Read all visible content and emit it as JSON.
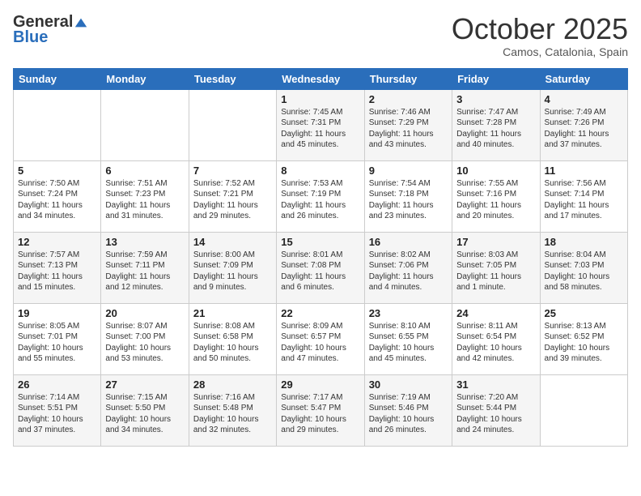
{
  "logo": {
    "general": "General",
    "blue": "Blue"
  },
  "title": "October 2025",
  "location": "Camos, Catalonia, Spain",
  "days_of_week": [
    "Sunday",
    "Monday",
    "Tuesday",
    "Wednesday",
    "Thursday",
    "Friday",
    "Saturday"
  ],
  "weeks": [
    [
      {
        "day": "",
        "info": ""
      },
      {
        "day": "",
        "info": ""
      },
      {
        "day": "",
        "info": ""
      },
      {
        "day": "1",
        "info": "Sunrise: 7:45 AM\nSunset: 7:31 PM\nDaylight: 11 hours and 45 minutes."
      },
      {
        "day": "2",
        "info": "Sunrise: 7:46 AM\nSunset: 7:29 PM\nDaylight: 11 hours and 43 minutes."
      },
      {
        "day": "3",
        "info": "Sunrise: 7:47 AM\nSunset: 7:28 PM\nDaylight: 11 hours and 40 minutes."
      },
      {
        "day": "4",
        "info": "Sunrise: 7:49 AM\nSunset: 7:26 PM\nDaylight: 11 hours and 37 minutes."
      }
    ],
    [
      {
        "day": "5",
        "info": "Sunrise: 7:50 AM\nSunset: 7:24 PM\nDaylight: 11 hours and 34 minutes."
      },
      {
        "day": "6",
        "info": "Sunrise: 7:51 AM\nSunset: 7:23 PM\nDaylight: 11 hours and 31 minutes."
      },
      {
        "day": "7",
        "info": "Sunrise: 7:52 AM\nSunset: 7:21 PM\nDaylight: 11 hours and 29 minutes."
      },
      {
        "day": "8",
        "info": "Sunrise: 7:53 AM\nSunset: 7:19 PM\nDaylight: 11 hours and 26 minutes."
      },
      {
        "day": "9",
        "info": "Sunrise: 7:54 AM\nSunset: 7:18 PM\nDaylight: 11 hours and 23 minutes."
      },
      {
        "day": "10",
        "info": "Sunrise: 7:55 AM\nSunset: 7:16 PM\nDaylight: 11 hours and 20 minutes."
      },
      {
        "day": "11",
        "info": "Sunrise: 7:56 AM\nSunset: 7:14 PM\nDaylight: 11 hours and 17 minutes."
      }
    ],
    [
      {
        "day": "12",
        "info": "Sunrise: 7:57 AM\nSunset: 7:13 PM\nDaylight: 11 hours and 15 minutes."
      },
      {
        "day": "13",
        "info": "Sunrise: 7:59 AM\nSunset: 7:11 PM\nDaylight: 11 hours and 12 minutes."
      },
      {
        "day": "14",
        "info": "Sunrise: 8:00 AM\nSunset: 7:09 PM\nDaylight: 11 hours and 9 minutes."
      },
      {
        "day": "15",
        "info": "Sunrise: 8:01 AM\nSunset: 7:08 PM\nDaylight: 11 hours and 6 minutes."
      },
      {
        "day": "16",
        "info": "Sunrise: 8:02 AM\nSunset: 7:06 PM\nDaylight: 11 hours and 4 minutes."
      },
      {
        "day": "17",
        "info": "Sunrise: 8:03 AM\nSunset: 7:05 PM\nDaylight: 11 hours and 1 minute."
      },
      {
        "day": "18",
        "info": "Sunrise: 8:04 AM\nSunset: 7:03 PM\nDaylight: 10 hours and 58 minutes."
      }
    ],
    [
      {
        "day": "19",
        "info": "Sunrise: 8:05 AM\nSunset: 7:01 PM\nDaylight: 10 hours and 55 minutes."
      },
      {
        "day": "20",
        "info": "Sunrise: 8:07 AM\nSunset: 7:00 PM\nDaylight: 10 hours and 53 minutes."
      },
      {
        "day": "21",
        "info": "Sunrise: 8:08 AM\nSunset: 6:58 PM\nDaylight: 10 hours and 50 minutes."
      },
      {
        "day": "22",
        "info": "Sunrise: 8:09 AM\nSunset: 6:57 PM\nDaylight: 10 hours and 47 minutes."
      },
      {
        "day": "23",
        "info": "Sunrise: 8:10 AM\nSunset: 6:55 PM\nDaylight: 10 hours and 45 minutes."
      },
      {
        "day": "24",
        "info": "Sunrise: 8:11 AM\nSunset: 6:54 PM\nDaylight: 10 hours and 42 minutes."
      },
      {
        "day": "25",
        "info": "Sunrise: 8:13 AM\nSunset: 6:52 PM\nDaylight: 10 hours and 39 minutes."
      }
    ],
    [
      {
        "day": "26",
        "info": "Sunrise: 7:14 AM\nSunset: 5:51 PM\nDaylight: 10 hours and 37 minutes."
      },
      {
        "day": "27",
        "info": "Sunrise: 7:15 AM\nSunset: 5:50 PM\nDaylight: 10 hours and 34 minutes."
      },
      {
        "day": "28",
        "info": "Sunrise: 7:16 AM\nSunset: 5:48 PM\nDaylight: 10 hours and 32 minutes."
      },
      {
        "day": "29",
        "info": "Sunrise: 7:17 AM\nSunset: 5:47 PM\nDaylight: 10 hours and 29 minutes."
      },
      {
        "day": "30",
        "info": "Sunrise: 7:19 AM\nSunset: 5:46 PM\nDaylight: 10 hours and 26 minutes."
      },
      {
        "day": "31",
        "info": "Sunrise: 7:20 AM\nSunset: 5:44 PM\nDaylight: 10 hours and 24 minutes."
      },
      {
        "day": "",
        "info": ""
      }
    ]
  ]
}
